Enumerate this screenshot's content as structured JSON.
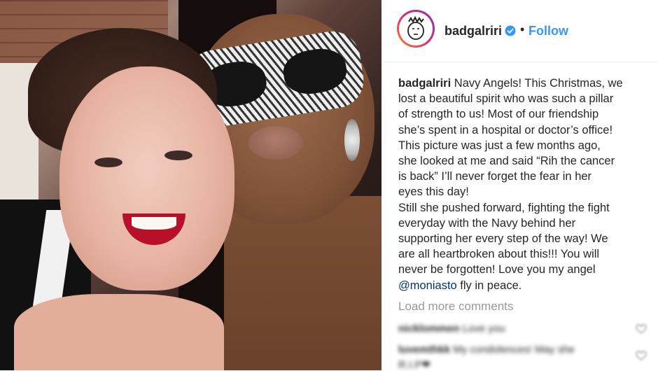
{
  "post": {
    "username": "badgalriri",
    "separator": "•",
    "follow_label": "Follow",
    "caption": {
      "username": "badgalriri",
      "lines": [
        "Navy Angels! This Christmas, we",
        "lost a beautiful spirit who was such a pillar",
        "of strength to us! Most of our friendship",
        "she’s spent in a hospital or doctor’s office!",
        "This picture was just a few months ago,",
        "she looked at me and said “Rih the cancer",
        "is back” I’ll never forget the fear in her",
        "eyes this day!",
        "Still she pushed forward, fighting the fight",
        "everyday with the Navy behind her",
        "supporting her every step of the way! We",
        "are all heartbroken about this!!! You will",
        "never be forgotten! Love you my angel"
      ],
      "mention": "@moniasto",
      "last_line_rest": " fly in peace."
    },
    "load_more_label": "Load more comments",
    "comments": [
      {
        "user": "nicklommen",
        "text": "Love you"
      },
      {
        "user": "luvemthkk",
        "text": "My condolences! May she"
      },
      {
        "user": "",
        "text": "R.I.P❤"
      }
    ],
    "icons": {
      "verified": "verified-badge-icon",
      "heart": "heart-icon"
    },
    "colors": {
      "accent_blue": "#3897f0",
      "text": "#262626",
      "muted": "#999999"
    }
  }
}
